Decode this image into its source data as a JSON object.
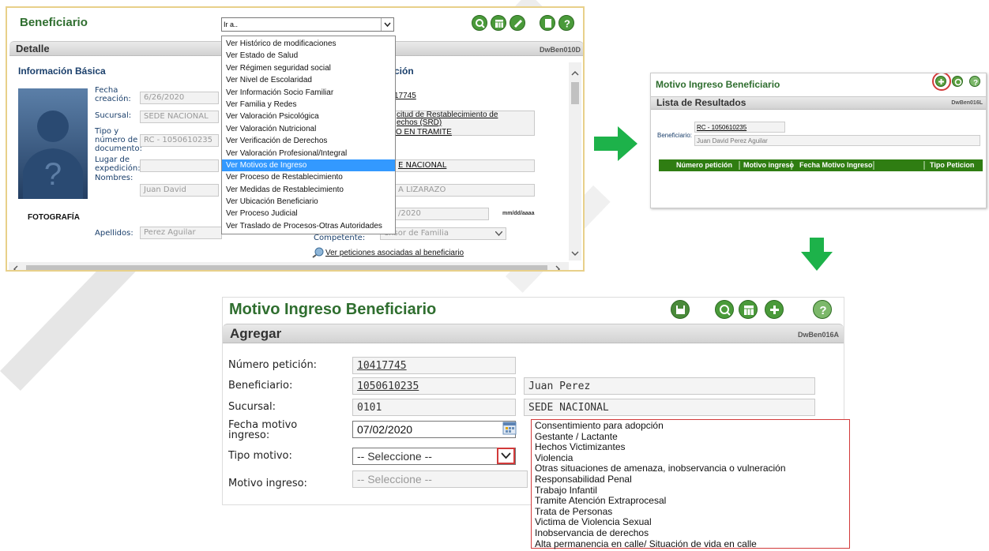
{
  "panel1": {
    "title": "Beneficiario",
    "goto_value": "Ir a..",
    "subheader": "Detalle",
    "screen_code": "DwBen010D",
    "section_basic": "Información Básica",
    "section_right_partial": "ción",
    "photo_label": "FOTOGRAFÍA",
    "labels": {
      "fecha": "Fecha creación:",
      "sucursal": "Sucursal:",
      "tipo_doc": "Tipo y número de documento:",
      "lugar": "Lugar de expedición:",
      "nombres": "Nombres:",
      "apellidos": "Apellidos:",
      "competente": "Competente:"
    },
    "values": {
      "fecha": "6/26/2020",
      "sucursal": "SEDE NACIONAL",
      "doc_type": "RC",
      "doc_number": "- 1050610235",
      "nombres": "Juan  David",
      "apellidos": "Perez Aguilar"
    },
    "right_partial": {
      "peticion": "17745",
      "solicitud_line1": "citud de Restablecimiento de",
      "solicitud_line2": "echos (SRD)",
      "estado": "O EN TRAMITE",
      "sede": "E NACIONAL",
      "funcionario": "A LIZARAZO",
      "fecha": "/2020",
      "date_format": "mm/dd/aaaa",
      "competente_value": "ensor de Familia"
    },
    "link_peticiones": "Ver peticiones asociadas al beneficiario",
    "menu_items": [
      "Ver Histórico de modificaciones",
      "Ver Estado de Salud",
      "Ver Régimen seguridad social",
      "Ver Nivel de Escolaridad",
      "Ver Información Socio Familiar",
      "Ver Familia y Redes",
      "Ver Valoración Psicológica",
      "Ver Valoración Nutricional",
      "Ver Verificación de Derechos",
      "Ver Valoración Profesional/Integral",
      "Ver Motivos de Ingreso",
      "Ver Proceso de Restablecimiento",
      "Ver Medidas de Restablecimiento",
      "Ver Ubicación Beneficiario",
      "Ver Proceso Judicial",
      "Ver Traslado de Procesos-Otras Autoridades"
    ],
    "selected_menu_item": "Ver Motivos de Ingreso"
  },
  "panel2": {
    "title": "Motivo Ingreso Beneficiario",
    "subheader": "Lista de Resultados",
    "screen_code": "DwBen016L",
    "beneficiario_label": "Beneficiario:",
    "beneficiario_doc": "RC - 1050610235",
    "beneficiario_name": "Juan  David Perez Aguilar",
    "columns": [
      "Número petición",
      "Motivo ingreso",
      "Fecha Motivo Ingreso",
      "Tipo Peticion"
    ]
  },
  "panel3": {
    "title": "Motivo Ingreso Beneficiario",
    "subheader": "Agregar",
    "screen_code": "DwBen016A",
    "labels": {
      "numero": "Número petición:",
      "beneficiario": "Beneficiario:",
      "sucursal": "Sucursal:",
      "fecha_l1": "Fecha motivo",
      "fecha_l2": "ingreso:",
      "tipo": "Tipo motivo:",
      "motivo": "Motivo ingreso:"
    },
    "values": {
      "numero": "10417745",
      "beneficiario_doc": "1050610235",
      "beneficiario_name": "Juan  Perez",
      "sucursal_code": "0101",
      "sucursal_name": "SEDE NACIONAL",
      "fecha": "07/02/2020",
      "tipo": "-- Seleccione --",
      "motivo": "-- Seleccione --"
    },
    "tipo_options": [
      "Consentimiento para adopción",
      "Gestante / Lactante",
      "Hechos Victimizantes",
      "Violencia",
      "Otras situaciones de amenaza, inobservancia o vulneración",
      "Responsabilidad Penal",
      "Trabajo Infantil",
      "Tramite Atención Extraprocesal",
      "Trata de Personas",
      "Victima de Violencia Sexual",
      "Inobservancia de derechos",
      "Alta permanencia en calle/ Situación de vida en calle"
    ]
  },
  "colors": {
    "title_green": "#2f6e2f",
    "arrow_green": "#1db24a",
    "table_header_green": "#2f7d12",
    "highlight_red": "#d23a3a",
    "menu_selected": "#3399ff"
  },
  "icons": [
    "search-icon",
    "calendar-icon",
    "edit-icon",
    "document-icon",
    "help-icon",
    "add-icon",
    "refresh-icon",
    "save-icon",
    "arrow-right-icon",
    "arrow-down-icon",
    "dropdown-chevron-icon"
  ]
}
